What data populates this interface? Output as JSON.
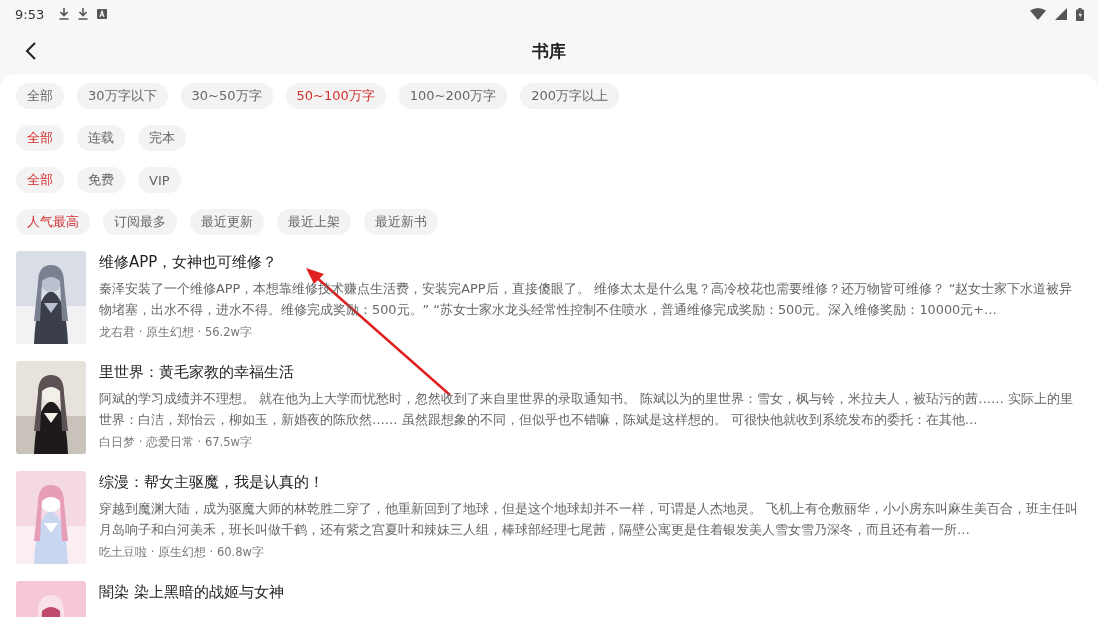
{
  "status_bar": {
    "time": "9:53"
  },
  "header": {
    "title": "书库"
  },
  "filters": [
    {
      "options": [
        {
          "label": "全部",
          "selected": false
        },
        {
          "label": "30万字以下",
          "selected": false
        },
        {
          "label": "30~50万字",
          "selected": false
        },
        {
          "label": "50~100万字",
          "selected": true
        },
        {
          "label": "100~200万字",
          "selected": false
        },
        {
          "label": "200万字以上",
          "selected": false
        }
      ]
    },
    {
      "options": [
        {
          "label": "全部",
          "selected": true
        },
        {
          "label": "连载",
          "selected": false
        },
        {
          "label": "完本",
          "selected": false
        }
      ]
    },
    {
      "options": [
        {
          "label": "全部",
          "selected": true
        },
        {
          "label": "免费",
          "selected": false
        },
        {
          "label": "VIP",
          "selected": false
        }
      ]
    },
    {
      "options": [
        {
          "label": "人气最高",
          "selected": true
        },
        {
          "label": "订阅最多",
          "selected": false
        },
        {
          "label": "最近更新",
          "selected": false
        },
        {
          "label": "最近上架",
          "selected": false
        },
        {
          "label": "最近新书",
          "selected": false
        }
      ]
    }
  ],
  "books": [
    {
      "title": "维修APP，女神也可维修？",
      "description": "秦泽安装了一个维修APP，本想靠维修技术赚点生活费，安装完APP后，直接傻眼了。 维修太太是什么鬼？高冷校花也需要维修？还万物皆可维修？ “赵女士家下水道被异物堵塞，出水不得，进水不得。维修完成奖励：500元。” “苏女士家水龙头经常性控制不住喷水，普通维修完成奖励：500元。深入维修奖励：10000元+…",
      "meta": "龙右君 · 原生幻想 · 56.2w字"
    },
    {
      "title": "里世界：黄毛家教的幸福生活",
      "description": "阿斌的学习成绩并不理想。 就在他为上大学而忧愁时，忽然收到了来自里世界的录取通知书。 陈斌以为的里世界：雪女，枫与铃，米拉夫人，被玷污的茜…… 实际上的里世界：白洁，郑怡云，柳如玉，新婚夜的陈欣然…… 虽然跟想象的不同，但似乎也不错嘛，陈斌是这样想的。 可很快他就收到系统发布的委托：在其他…",
      "meta": "白日梦 · 恋爱日常 · 67.5w字"
    },
    {
      "title": "综漫：帮女主驱魔，我是认真的！",
      "description": "穿越到魔渊大陆，成为驱魔大师的林乾胜二穿了，他重新回到了地球，但是这个地球却并不一样，可谓是人杰地灵。 飞机上有仓敷丽华，小小房东叫麻生美百合，班主任叫月岛响子和白河美禾，班长叫做千鹤，还有紫之宫夏叶和辣妹三人组，棒球部经理七尾茜，隔壁公寓更是住着银发美人雪女雪乃深冬，而且还有着一所…",
      "meta": "吃土豆啦 · 原生幻想 · 60.8w字"
    },
    {
      "title": "闇染 染上黑暗的战姬与女神"
    }
  ]
}
